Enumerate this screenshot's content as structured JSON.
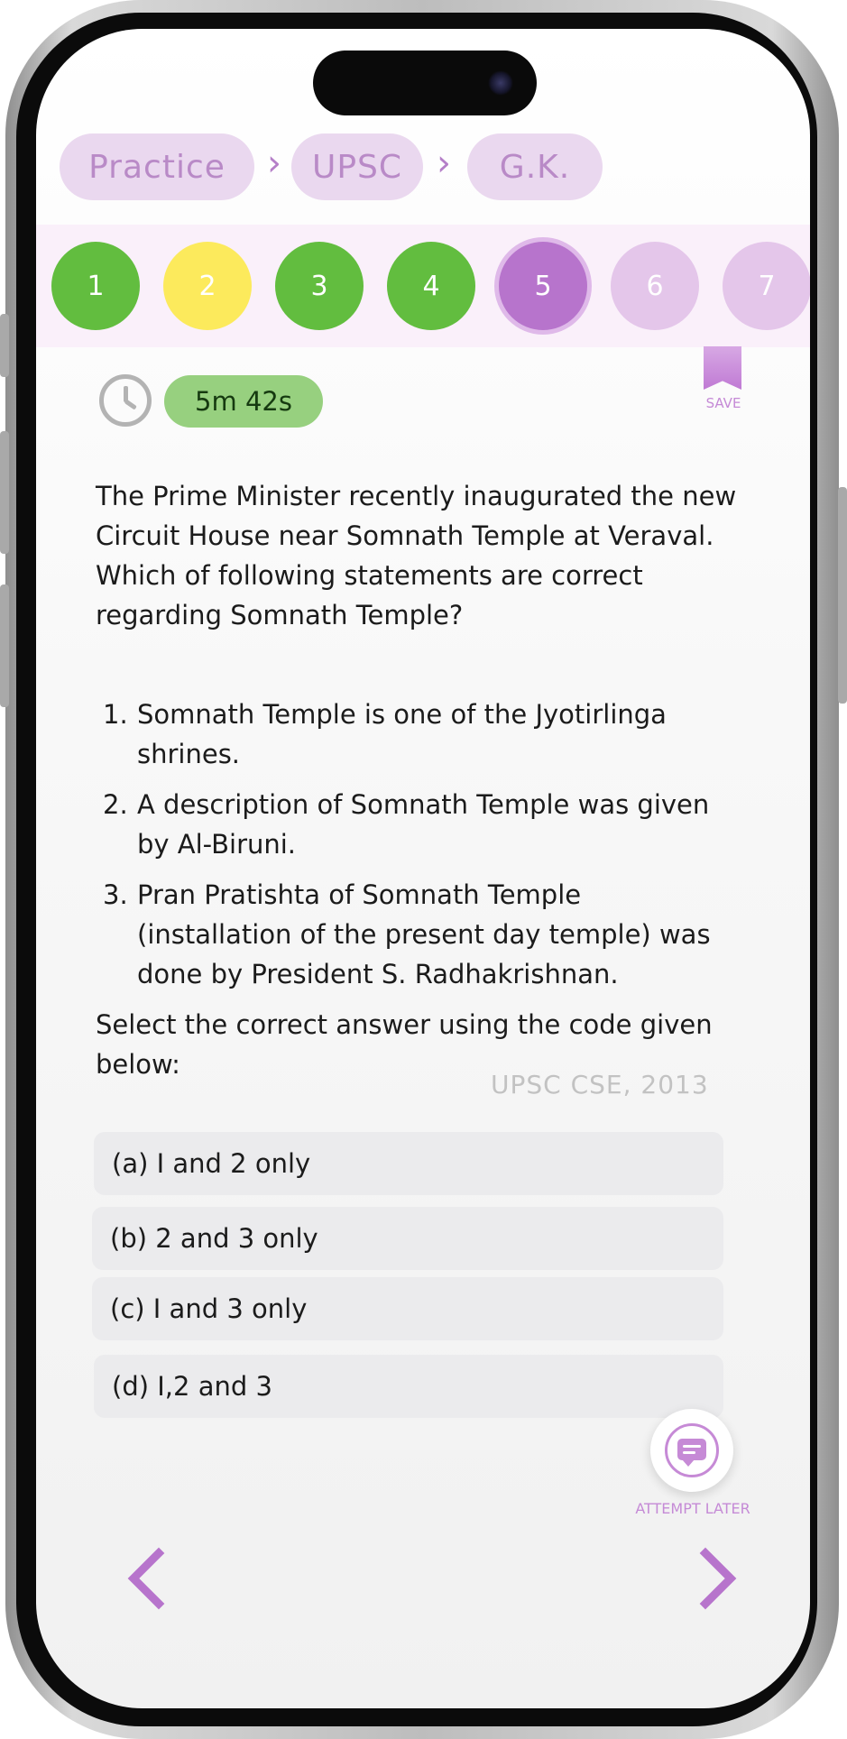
{
  "breadcrumb": {
    "items": [
      "Practice",
      "UPSC",
      "G.K."
    ],
    "separator": "›"
  },
  "questions": {
    "items": [
      {
        "label": "1",
        "status": "answered",
        "color": "#62bd3f"
      },
      {
        "label": "2",
        "status": "review",
        "color": "#fcea5c"
      },
      {
        "label": "3",
        "status": "answered",
        "color": "#62bd3f"
      },
      {
        "label": "4",
        "status": "answered",
        "color": "#62bd3f"
      },
      {
        "label": "5",
        "status": "current",
        "color": "#b774cc"
      },
      {
        "label": "6",
        "status": "unvisited",
        "color": "#e4c6ea"
      },
      {
        "label": "7",
        "status": "unvisited",
        "color": "#e4c6ea"
      }
    ]
  },
  "timer": {
    "icon": "clock-icon",
    "value": "5m 42s"
  },
  "save": {
    "icon": "bookmark-icon",
    "label": "SAVE"
  },
  "question": {
    "stem": "The Prime Minister recently inaugurated the new Circuit House near Somnath Temple at Veraval. Which of following statements are correct regarding Somnath Temple?",
    "statements": [
      {
        "num": "1.",
        "text": "Somnath Temple is one of the Jyotirlinga shrines."
      },
      {
        "num": "2.",
        "text": "A description of Somnath Temple was given by Al-Biruni."
      },
      {
        "num": "3.",
        "text": "Pran Pratishta of Somnath Temple (installation of the present day temple) was done by President S. Radhakrishnan."
      }
    ],
    "instruction": "Select the correct answer using the code given below:",
    "source": "UPSC CSE, 2013"
  },
  "options": [
    {
      "text": "(a) I and 2 only"
    },
    {
      "text": "(b) 2 and 3 only"
    },
    {
      "text": "(c) I and 3 only"
    },
    {
      "text": "(d) I,2 and 3"
    }
  ],
  "attempt_later": {
    "icon": "chat-refresh-icon",
    "label": "ATTEMPT LATER"
  },
  "navigation": {
    "prev_icon": "chevron-left-icon",
    "next_icon": "chevron-right-icon"
  },
  "colors": {
    "accent": "#b774cc",
    "answered": "#62bd3f",
    "review": "#fcea5c",
    "unvisited": "#e4c6ea",
    "timer_bg": "#97d07f"
  }
}
